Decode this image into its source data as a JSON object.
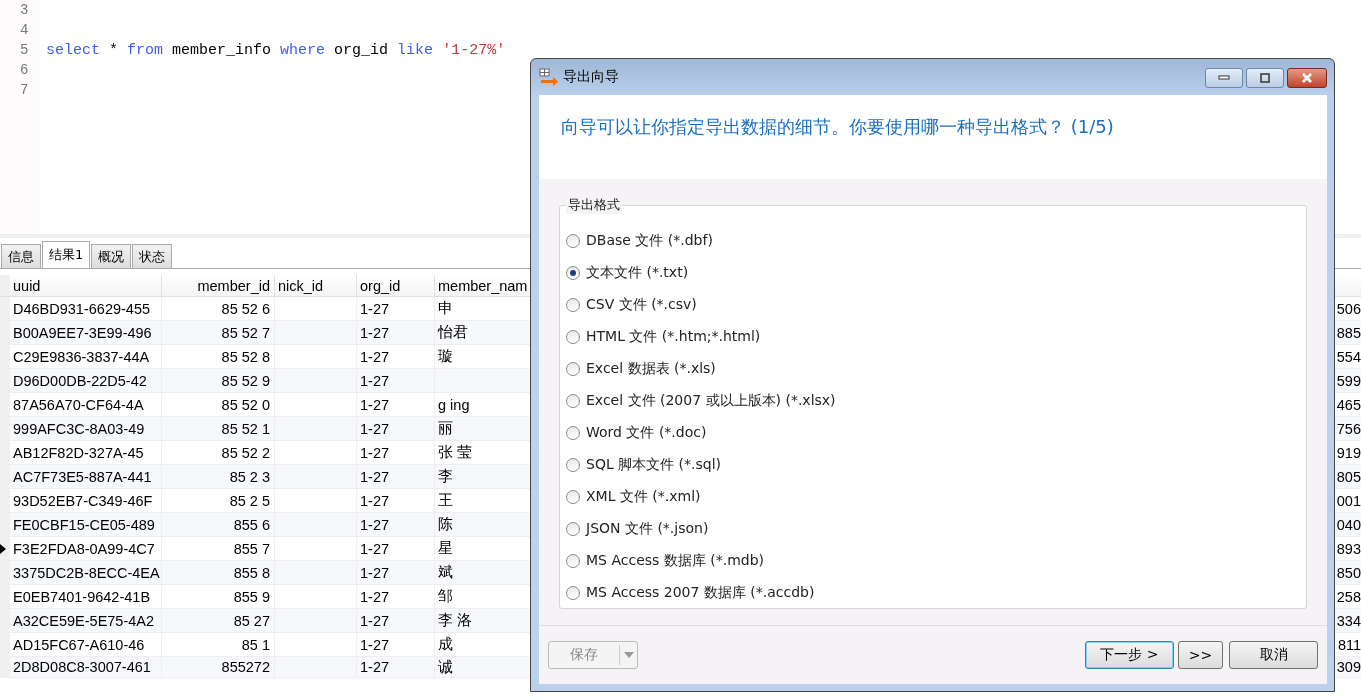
{
  "editor": {
    "lines": [
      {
        "number": "3"
      },
      {
        "number": "4"
      },
      {
        "number": "5",
        "tokens": [
          {
            "kind": "keyword",
            "text": "select"
          },
          {
            "kind": "plain",
            "text": " * "
          },
          {
            "kind": "keyword",
            "text": "from"
          },
          {
            "kind": "plain",
            "text": " member_info "
          },
          {
            "kind": "keyword",
            "text": "where"
          },
          {
            "kind": "plain",
            "text": " org_id "
          },
          {
            "kind": "keyword",
            "text": "like "
          },
          {
            "kind": "string",
            "text": "'1-27%'"
          }
        ]
      },
      {
        "number": "6"
      },
      {
        "number": "7"
      }
    ]
  },
  "result_tabs": [
    {
      "label": "信息",
      "selected": false
    },
    {
      "label": "结果1",
      "selected": true
    },
    {
      "label": "概况",
      "selected": false
    },
    {
      "label": "状态",
      "selected": false
    }
  ],
  "table": {
    "columns": [
      "uuid",
      "member_id",
      "nick_id",
      "org_id",
      "member_nam"
    ],
    "rows": [
      {
        "uuid": "D46BD931-6629-455",
        "member_id": "85 52 6",
        "org_id": "1-27",
        "name": "申",
        "column_6": "506",
        "current": false
      },
      {
        "uuid": "B00A9EE7-3E99-496",
        "member_id": "85 52 7",
        "org_id": "1-27",
        "name": "怡君",
        "column_6": "885",
        "current": false
      },
      {
        "uuid": "C29E9836-3837-44A",
        "member_id": "85 52 8",
        "org_id": "1-27",
        "name": "璇",
        "column_6": "554",
        "current": false
      },
      {
        "uuid": "D96D00DB-22D5-42",
        "member_id": "85 52 9",
        "org_id": "1-27",
        "column_6": "599",
        "current": false
      },
      {
        "uuid": "87A56A70-CF64-4A",
        "member_id": "85 52 0",
        "org_id": "1-27",
        "name": "g ing",
        "column_6": "465",
        "current": false
      },
      {
        "uuid": "999AFC3C-8A03-49",
        "member_id": "85 52 1",
        "org_id": "1-27",
        "name": "丽",
        "column_6": "756",
        "current": false
      },
      {
        "uuid": "AB12F82D-327A-45",
        "member_id": "85 52 2",
        "org_id": "1-27",
        "name": "张 莹",
        "column_6": "919",
        "current": false
      },
      {
        "uuid": "AC7F73E5-887A-441",
        "member_id": "85 2 3",
        "org_id": "1-27",
        "name": "李",
        "column_6": "805",
        "current": false
      },
      {
        "uuid": "93D52EB7-C349-46F",
        "member_id": "85 2 5",
        "org_id": "1-27",
        "name": "王",
        "column_6": "001",
        "current": false
      },
      {
        "uuid": "FE0CBF15-CE05-489",
        "member_id": "855 6",
        "org_id": "1-27",
        "name": "陈",
        "column_6": "040",
        "current": false
      },
      {
        "uuid": "F3E2FDA8-0A99-4C7",
        "member_id": "855 7",
        "org_id": "1-27",
        "name": "星",
        "column_6": "893",
        "current": true
      },
      {
        "uuid": "3375DC2B-8ECC-4EA",
        "member_id": "855 8",
        "org_id": "1-27",
        "name": "斌",
        "column_6": "850",
        "current": false
      },
      {
        "uuid": "E0EB7401-9642-41B",
        "member_id": "855 9",
        "org_id": "1-27",
        "name": "邹",
        "column_6": "258",
        "current": false
      },
      {
        "uuid": "A32CE59E-5E75-4A2",
        "member_id": "85 27",
        "org_id": "1-27",
        "name": "李 洛",
        "column_6": "334",
        "current": false
      },
      {
        "uuid": "AD15FC67-A610-46",
        "member_id": "85 1",
        "org_id": "1-27",
        "name": "成",
        "column_6": "811",
        "current": false
      },
      {
        "uuid": "2D8D08C8-3007-461",
        "member_id": "855272",
        "org_id": "1-27",
        "name": "诚",
        "column_6": "309",
        "current": false
      }
    ]
  },
  "dialog": {
    "title": "导出向导",
    "heading": "向导可以让你指定导出数据的细节。你要使用哪一种导出格式？ (1/5)",
    "group_label": "导出格式",
    "formats": [
      {
        "label": "DBase 文件 (*.dbf)",
        "selected": false
      },
      {
        "label": "文本文件 (*.txt)",
        "selected": true
      },
      {
        "label": "CSV 文件 (*.csv)",
        "selected": false
      },
      {
        "label": "HTML 文件 (*.htm;*.html)",
        "selected": false
      },
      {
        "label": "Excel 数据表 (*.xls)",
        "selected": false
      },
      {
        "label": "Excel 文件 (2007 或以上版本) (*.xlsx)",
        "selected": false
      },
      {
        "label": "Word 文件 (*.doc)",
        "selected": false
      },
      {
        "label": "SQL 脚本文件 (*.sql)",
        "selected": false
      },
      {
        "label": "XML 文件 (*.xml)",
        "selected": false
      },
      {
        "label": "JSON 文件 (*.json)",
        "selected": false
      },
      {
        "label": "MS Access 数据库 (*.mdb)",
        "selected": false
      },
      {
        "label": "MS Access 2007 数据库 (*.accdb)",
        "selected": false
      }
    ],
    "save_button": {
      "label": "保存",
      "disabled": true
    },
    "next_button": "下一步 >",
    "finish_button": ">>",
    "cancel_button": "取消"
  }
}
